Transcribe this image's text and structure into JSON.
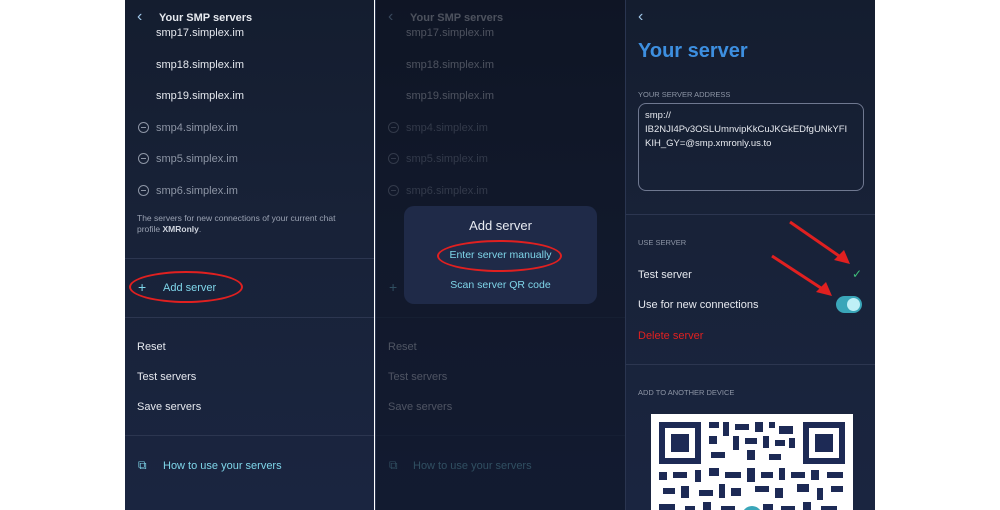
{
  "panel1": {
    "title": "Your SMP servers",
    "servers_enabled": [
      "smp17.simplex.im",
      "smp18.simplex.im",
      "smp19.simplex.im"
    ],
    "servers_disabled": [
      "smp4.simplex.im",
      "smp5.simplex.im",
      "smp6.simplex.im"
    ],
    "note_prefix": "The servers for new connections of your current chat profile ",
    "note_profile": "XMRonly",
    "note_suffix": ".",
    "add_server": "Add server",
    "reset": "Reset",
    "test_servers": "Test servers",
    "save_servers": "Save servers",
    "how_to": "How to use your servers"
  },
  "modal": {
    "title": "Add server",
    "enter_manually": "Enter server manually",
    "scan_qr": "Scan server QR code"
  },
  "panel3": {
    "title": "Your server",
    "address_label": "YOUR SERVER ADDRESS",
    "address_line1": "smp://",
    "address_line2": "IB2NJI4Pv3OSLUmnvipKkCuJKGkEDfgUNkYFI",
    "address_line3": "KIH_GY=@smp.xmronly.us.to",
    "use_server_label": "USE SERVER",
    "test_server": "Test server",
    "use_for_new": "Use for new connections",
    "use_for_new_enabled": true,
    "delete_server": "Delete server",
    "add_device_label": "ADD TO ANOTHER DEVICE"
  },
  "colors": {
    "panel_bg": "#182238",
    "accent": "#7fd6ea",
    "title_blue": "#3d8fe0",
    "danger": "#e02020",
    "check_green": "#3fbf7a"
  },
  "icons": {
    "back": "chevron-left-icon",
    "disabled": "minus-circle-icon",
    "add": "plus-icon",
    "link": "external-link-icon",
    "check": "check-icon"
  }
}
